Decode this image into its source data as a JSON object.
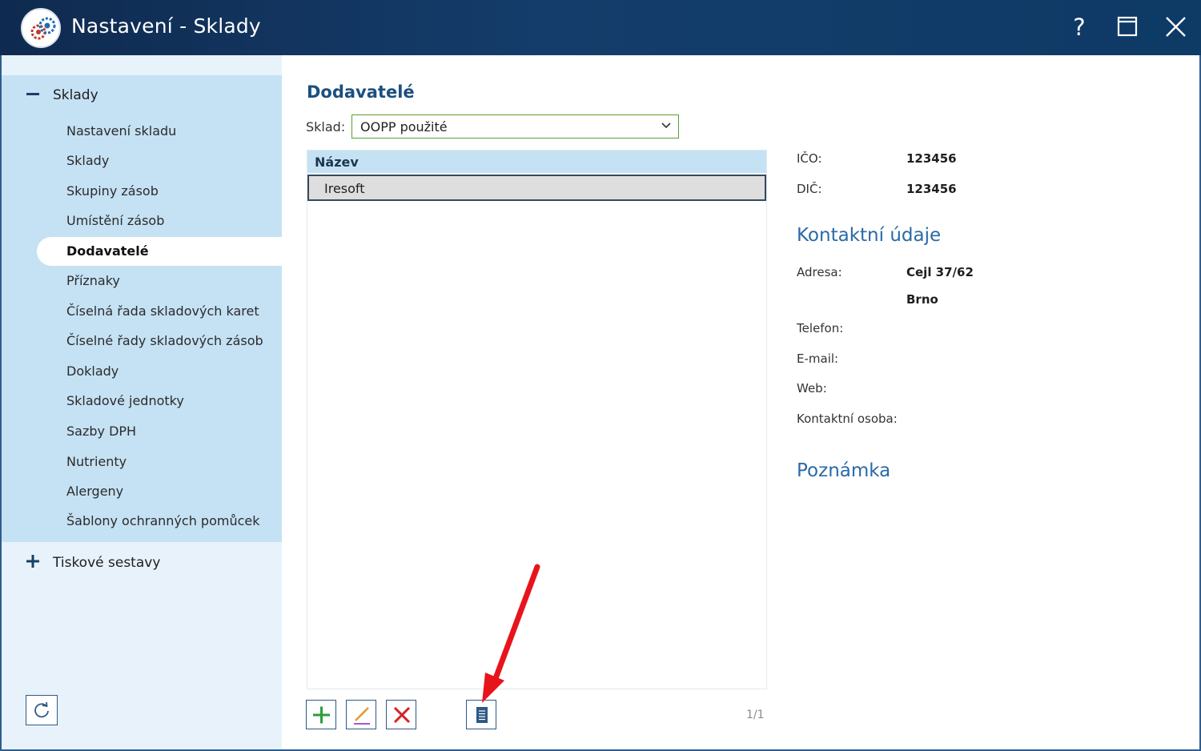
{
  "window": {
    "title": "Nastavení - Sklady",
    "help_label": "?"
  },
  "sidebar": {
    "groups": [
      {
        "label": "Sklady",
        "expanded": true,
        "items": [
          {
            "label": "Nastavení skladu"
          },
          {
            "label": "Sklady"
          },
          {
            "label": "Skupiny zásob"
          },
          {
            "label": "Umístění zásob"
          },
          {
            "label": "Dodavatelé",
            "active": true
          },
          {
            "label": "Příznaky"
          },
          {
            "label": "Číselná řada skladových karet"
          },
          {
            "label": "Číselné řady skladových zásob"
          },
          {
            "label": "Doklady"
          },
          {
            "label": "Skladové jednotky"
          },
          {
            "label": "Sazby DPH"
          },
          {
            "label": "Nutrienty"
          },
          {
            "label": "Alergeny"
          },
          {
            "label": "Šablony ochranných pomůcek"
          }
        ]
      },
      {
        "label": "Tiskové sestavy",
        "expanded": false
      }
    ]
  },
  "main": {
    "title": "Dodavatelé",
    "sklad_label": "Sklad:",
    "sklad_value": "OOPP použité",
    "list": {
      "column": "Název",
      "rows": [
        "Iresoft"
      ]
    },
    "pager": "1/1"
  },
  "detail": {
    "ico_label": "IČO:",
    "ico_value": "123456",
    "dic_label": "DIČ:",
    "dic_value": "123456",
    "contact_heading": "Kontaktní údaje",
    "address_label": "Adresa:",
    "address_line1": "Cejl 37/62",
    "address_line2": "Brno",
    "phone_label": "Telefon:",
    "email_label": "E-mail:",
    "web_label": "Web:",
    "contact_person_label": "Kontaktní osoba:",
    "note_heading": "Poznámka"
  },
  "colors": {
    "titlebar": "#143d6b",
    "sidebar_group": "#c5e2f4",
    "accent": "#1b4f80",
    "select_border": "#5b9e2f",
    "add_icon": "#2e9c3f",
    "delete_icon": "#d6232a",
    "annotation_arrow": "#e8141b"
  },
  "icons": {
    "add": "plus-icon",
    "edit": "pencil-icon",
    "delete": "x-icon",
    "detail": "document-icon",
    "refresh": "refresh-icon"
  }
}
